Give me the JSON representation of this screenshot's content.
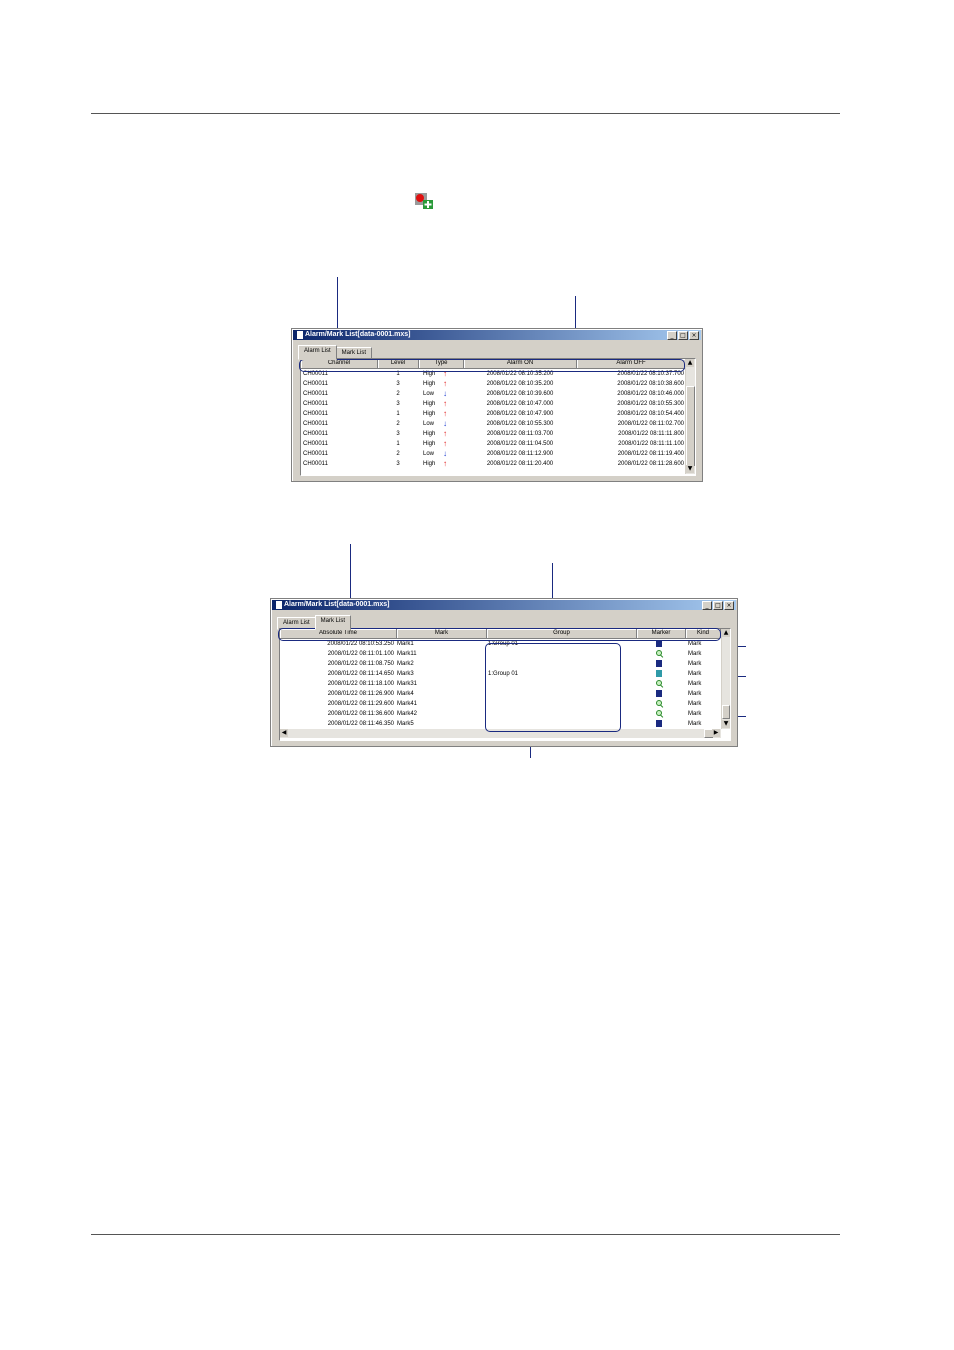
{
  "alarm_window": {
    "title": "Alarm/Mark List[data-0001.mxs]",
    "tabs": [
      "Alarm List",
      "Mark List"
    ],
    "columns": [
      "Channel",
      "Level",
      "Type",
      "Alarm ON",
      "Alarm OFF"
    ],
    "rows": [
      {
        "channel": "CH00011",
        "level": "1",
        "type": "High",
        "dir": "up",
        "on": "2008/01/22 08:10:35.200",
        "off": "2008/01/22 08:10:37.700"
      },
      {
        "channel": "CH00011",
        "level": "3",
        "type": "High",
        "dir": "up",
        "on": "2008/01/22 08:10:35.200",
        "off": "2008/01/22 08:10:38.600"
      },
      {
        "channel": "CH00011",
        "level": "2",
        "type": "Low",
        "dir": "down",
        "on": "2008/01/22 08:10:39.600",
        "off": "2008/01/22 08:10:46.000"
      },
      {
        "channel": "CH00011",
        "level": "3",
        "type": "High",
        "dir": "up",
        "on": "2008/01/22 08:10:47.000",
        "off": "2008/01/22 08:10:55.300"
      },
      {
        "channel": "CH00011",
        "level": "1",
        "type": "High",
        "dir": "up",
        "on": "2008/01/22 08:10:47.900",
        "off": "2008/01/22 08:10:54.400"
      },
      {
        "channel": "CH00011",
        "level": "2",
        "type": "Low",
        "dir": "down",
        "on": "2008/01/22 08:10:55.300",
        "off": "2008/01/22 08:11:02.700"
      },
      {
        "channel": "CH00011",
        "level": "3",
        "type": "High",
        "dir": "up",
        "on": "2008/01/22 08:11:03.700",
        "off": "2008/01/22 08:11:11.800"
      },
      {
        "channel": "CH00011",
        "level": "1",
        "type": "High",
        "dir": "up",
        "on": "2008/01/22 08:11:04.500",
        "off": "2008/01/22 08:11:11.100"
      },
      {
        "channel": "CH00011",
        "level": "2",
        "type": "Low",
        "dir": "down",
        "on": "2008/01/22 08:11:12.900",
        "off": "2008/01/22 08:11:19.400"
      },
      {
        "channel": "CH00011",
        "level": "3",
        "type": "High",
        "dir": "up",
        "on": "2008/01/22 08:11:20.400",
        "off": "2008/01/22 08:11:28.600"
      }
    ]
  },
  "mark_window": {
    "title": "Alarm/Mark List[data-0001.mxs]",
    "tabs": [
      "Alarm List",
      "Mark List"
    ],
    "columns": [
      "Absolute Time",
      "Mark",
      "Group",
      "Marker",
      "Kind"
    ],
    "rows": [
      {
        "time": "2008/01/22 08:10:53.250",
        "mark": "Mark1",
        "group": "1:Group 01",
        "marker": "book",
        "kind": "Mark"
      },
      {
        "time": "2008/01/22 08:11:01.100",
        "mark": "Mark11",
        "group": "",
        "marker": "search",
        "kind": "Mark"
      },
      {
        "time": "2008/01/22 08:11:08.750",
        "mark": "Mark2",
        "group": "",
        "marker": "book",
        "kind": "Mark"
      },
      {
        "time": "2008/01/22 08:11:14.650",
        "mark": "Mark3",
        "group": "1:Group 01",
        "marker": "book-light",
        "kind": "Mark"
      },
      {
        "time": "2008/01/22 08:11:18.100",
        "mark": "Mark31",
        "group": "",
        "marker": "search",
        "kind": "Mark"
      },
      {
        "time": "2008/01/22 08:11:26.900",
        "mark": "Mark4",
        "group": "",
        "marker": "book",
        "kind": "Mark"
      },
      {
        "time": "2008/01/22 08:11:29.600",
        "mark": "Mark41",
        "group": "",
        "marker": "search",
        "kind": "Mark"
      },
      {
        "time": "2008/01/22 08:11:36.600",
        "mark": "Mark42",
        "group": "",
        "marker": "search",
        "kind": "Mark"
      },
      {
        "time": "2008/01/22 08:11:46.350",
        "mark": "Mark5",
        "group": "",
        "marker": "book",
        "kind": "Mark"
      }
    ]
  },
  "icons": {
    "toolbar": "alarm-mark-list-toolbar-icon",
    "window_controls": [
      "minimize-icon",
      "maximize-icon",
      "close-icon"
    ],
    "scroll": [
      "scroll-up-icon",
      "scroll-down-icon",
      "scroll-left-icon",
      "scroll-right-icon"
    ]
  },
  "colors": {
    "titlebar": "#0a246a",
    "callout": "#1a2a80",
    "alarm_high": "#e02020",
    "alarm_low": "#1a3ad0"
  }
}
